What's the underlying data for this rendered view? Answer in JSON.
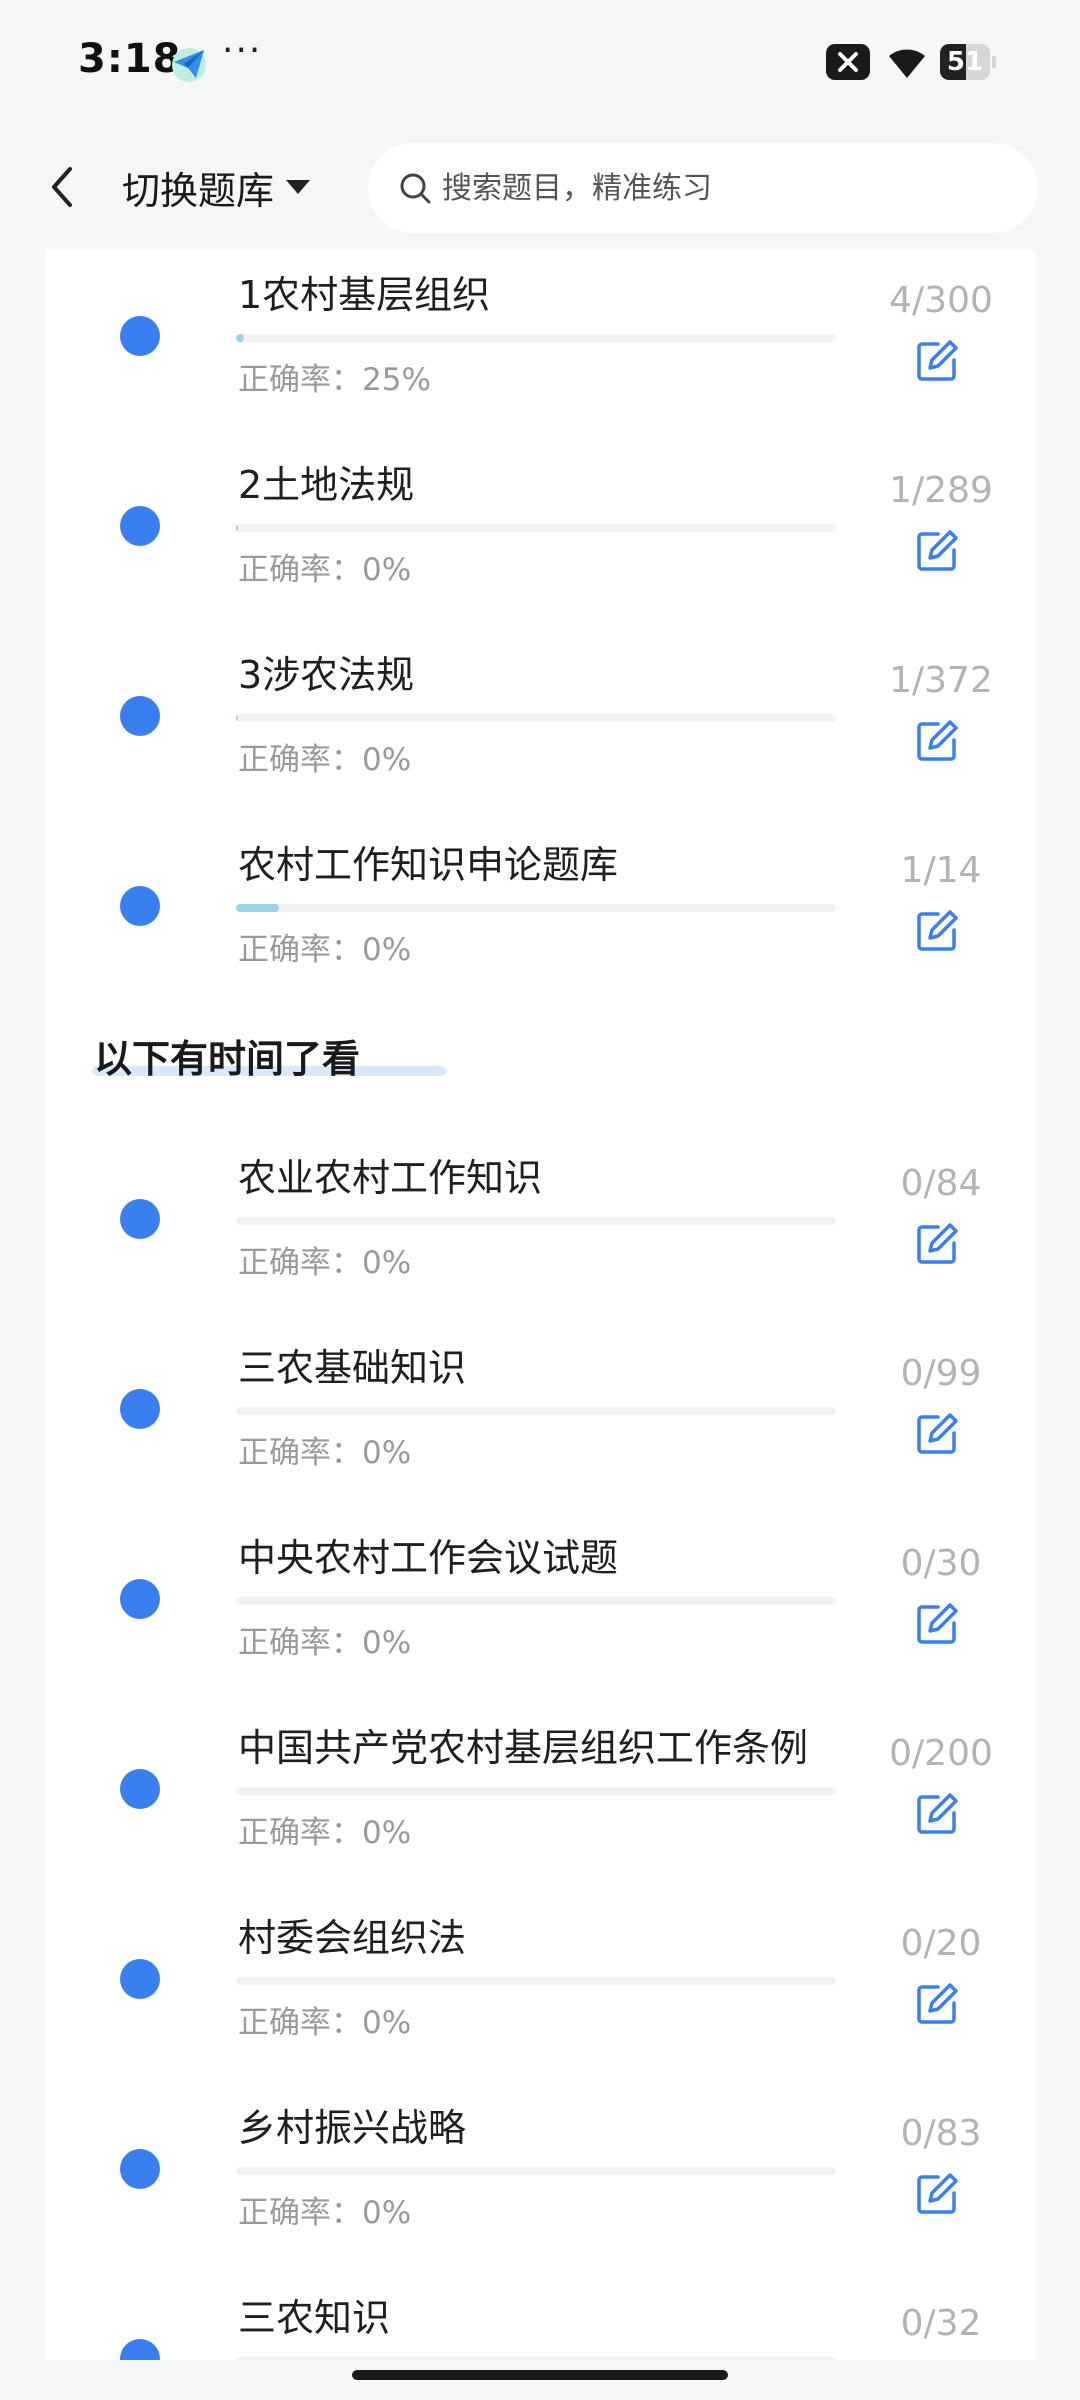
{
  "status_bar": {
    "time": "3:18",
    "more": "···",
    "battery_level": "51",
    "battery_fraction": 0.51
  },
  "header": {
    "switch_label": "切换题库",
    "search_placeholder": "搜索题目，精准练习"
  },
  "colors": {
    "accent_blue": "#3a7ff0",
    "progress_fill": "#9cd3ea",
    "muted_text": "#9a9a9a",
    "count_text": "#b3b3b3"
  },
  "main": {
    "section_heading": "以下有时间了看",
    "items": [
      {
        "title": "1农村基层组织",
        "accuracy": "正确率：25%",
        "count": "4/300",
        "progress": 0.013
      },
      {
        "title": "2土地法规",
        "accuracy": "正确率：0%",
        "count": "1/289",
        "progress": 0.0035
      },
      {
        "title": "3涉农法规",
        "accuracy": "正确率：0%",
        "count": "1/372",
        "progress": 0.0027
      },
      {
        "title": "农村工作知识申论题库",
        "accuracy": "正确率：0%",
        "count": "1/14",
        "progress": 0.071
      },
      {
        "title": "农业农村工作知识",
        "accuracy": "正确率：0%",
        "count": "0/84",
        "progress": 0
      },
      {
        "title": "三农基础知识",
        "accuracy": "正确率：0%",
        "count": "0/99",
        "progress": 0
      },
      {
        "title": "中央农村工作会议试题",
        "accuracy": "正确率：0%",
        "count": "0/30",
        "progress": 0
      },
      {
        "title": "中国共产党农村基层组织工作条例",
        "accuracy": "正确率：0%",
        "count": "0/200",
        "progress": 0
      },
      {
        "title": "村委会组织法",
        "accuracy": "正确率：0%",
        "count": "0/20",
        "progress": 0
      },
      {
        "title": "乡村振兴战略",
        "accuracy": "正确率：0%",
        "count": "0/83",
        "progress": 0
      },
      {
        "title": "三农知识",
        "accuracy": "",
        "count": "0/32",
        "progress": 0
      }
    ]
  }
}
